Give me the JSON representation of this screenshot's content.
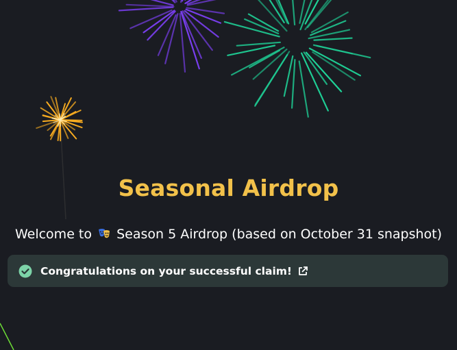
{
  "page": {
    "title": "Seasonal Airdrop",
    "welcome_prefix": "Welcome to",
    "welcome_suffix": "Season 5 Airdrop (based on October 31 snapshot)",
    "season_icon": "theater-masks-icon"
  },
  "banner": {
    "status_icon": "check-circle-icon",
    "message": "Congratulations on your successful claim!",
    "link_icon": "external-link-icon"
  },
  "colors": {
    "background": "#1a1c22",
    "title": "#f2c14a",
    "banner_bg": "#2c3838",
    "success": "#7dd3a8",
    "firework_purple": "#7b3ff2",
    "firework_green": "#1fd69a",
    "firework_gold": "#ffb020",
    "firework_lime": "#7cff3a"
  }
}
